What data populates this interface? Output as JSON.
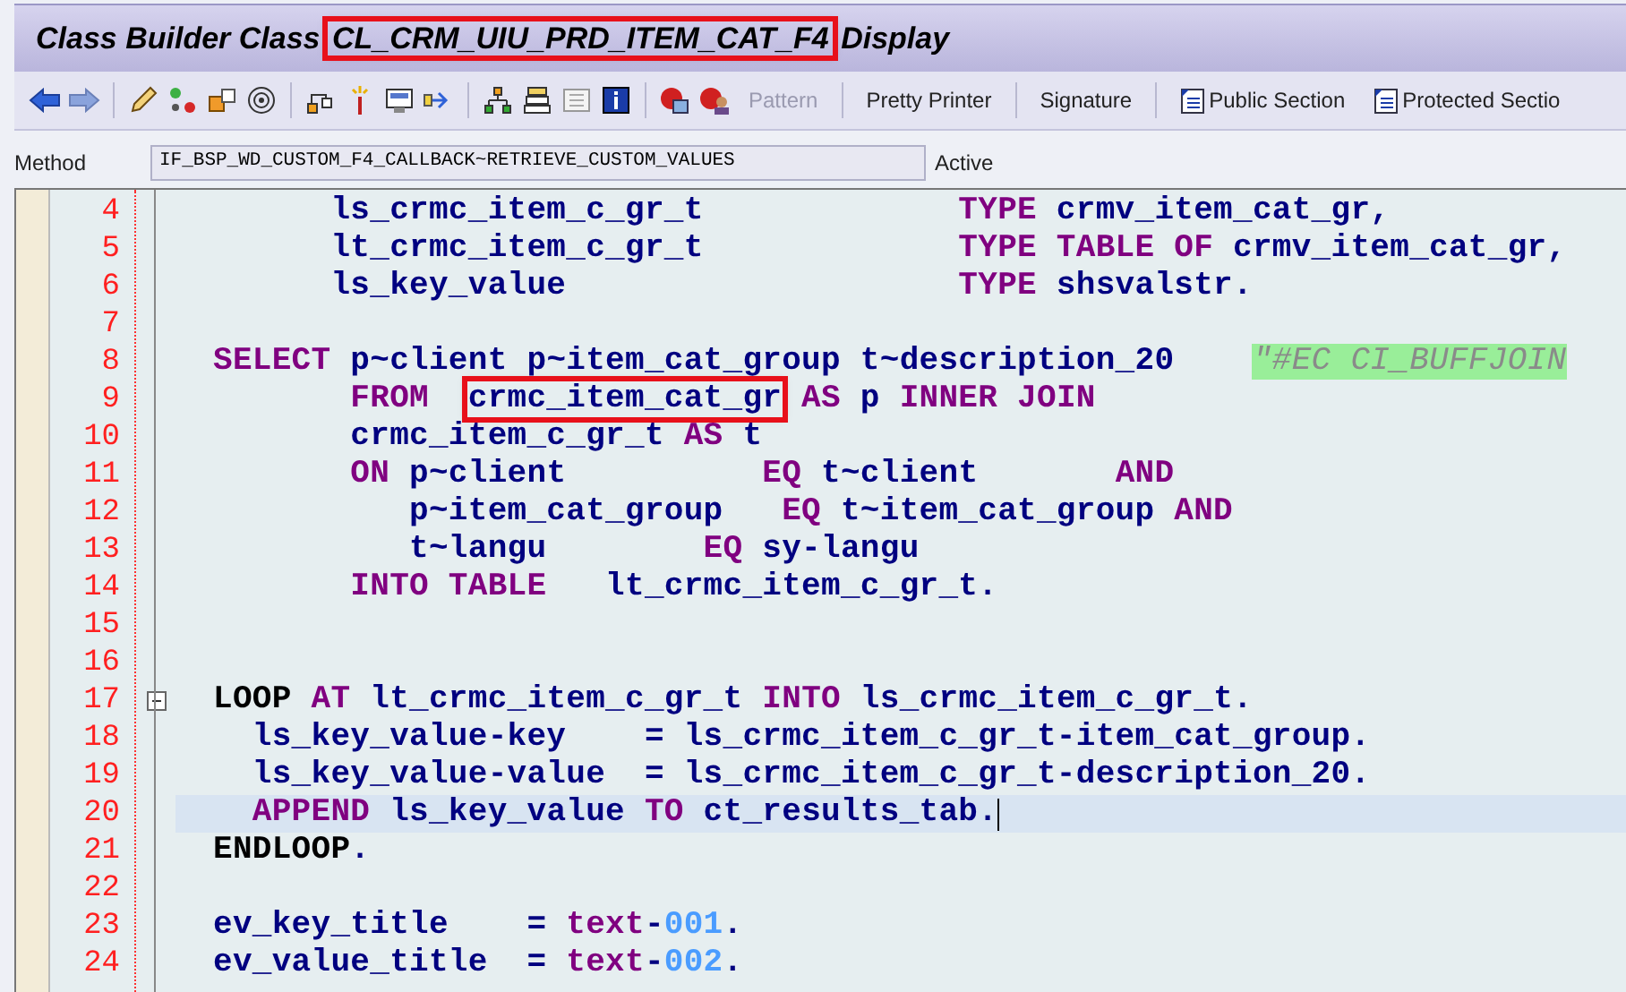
{
  "window": {
    "title": [
      {
        "text": "Class Builder Class ",
        "boxed": false
      },
      {
        "text": "CL_CRM_UIU_PRD_ITEM_CAT_F4",
        "boxed": true
      },
      {
        "text": " Display",
        "boxed": false
      }
    ]
  },
  "toolbar": {
    "buttons": [
      {
        "label": "Pattern",
        "disabled": true,
        "kind": "text"
      },
      {
        "label": "Pretty Printer",
        "disabled": false,
        "kind": "text"
      },
      {
        "label": "Signature",
        "disabled": false,
        "kind": "text"
      },
      {
        "label": "Public Section",
        "disabled": false,
        "kind": "doc"
      },
      {
        "label": "Protected Sectio",
        "disabled": false,
        "kind": "doc"
      }
    ]
  },
  "method_bar": {
    "label": "Method",
    "value": "IF_BSP_WD_CUSTOM_F4_CALLBACK~RETRIEVE_CUSTOM_VALUES",
    "status": "Active"
  },
  "editor": {
    "lines": [
      {
        "number": "4",
        "current": false,
        "fold": false,
        "segments": [
          {
            "kind": "ident",
            "text": "      ls_crmc_item_c_gr_t             "
          },
          {
            "kind": "keyword",
            "text": "TYPE"
          },
          {
            "kind": "ident",
            "text": " crmv_item_cat_gr,"
          }
        ]
      },
      {
        "number": "5",
        "current": false,
        "fold": false,
        "segments": [
          {
            "kind": "ident",
            "text": "      lt_crmc_item_c_gr_t             "
          },
          {
            "kind": "keyword",
            "text": "TYPE TABLE OF"
          },
          {
            "kind": "ident",
            "text": " crmv_item_cat_gr,"
          }
        ]
      },
      {
        "number": "6",
        "current": false,
        "fold": false,
        "segments": [
          {
            "kind": "ident",
            "text": "      ls_key_value                    "
          },
          {
            "kind": "keyword",
            "text": "TYPE"
          },
          {
            "kind": "ident",
            "text": " shsvalstr."
          }
        ]
      },
      {
        "number": "7",
        "current": false,
        "fold": false
      },
      {
        "number": "8",
        "current": false,
        "fold": false,
        "segments": [
          {
            "kind": "keyword",
            "text": "SELECT"
          },
          {
            "kind": "ident",
            "text": " p~client p~item_cat_group t~description_20    "
          },
          {
            "kind": "comment",
            "text": "\"#EC CI_BUFFJOIN"
          }
        ]
      },
      {
        "number": "9",
        "current": false,
        "fold": false,
        "segments": [
          {
            "kind": "keyword",
            "text": "       FROM  "
          },
          {
            "kind": "ident",
            "text": "crmc_item_cat_gr",
            "boxed": true
          },
          {
            "kind": "keyword",
            "text": " AS"
          },
          {
            "kind": "ident",
            "text": " p "
          },
          {
            "kind": "keyword",
            "text": "INNER JOIN"
          }
        ]
      },
      {
        "number": "10",
        "current": false,
        "fold": false,
        "segments": [
          {
            "kind": "ident",
            "text": "       crmc_item_c_gr_t "
          },
          {
            "kind": "keyword",
            "text": "AS"
          },
          {
            "kind": "ident",
            "text": " t"
          }
        ]
      },
      {
        "number": "11",
        "current": false,
        "fold": false,
        "segments": [
          {
            "kind": "keyword",
            "text": "       ON"
          },
          {
            "kind": "ident",
            "text": " p~client          "
          },
          {
            "kind": "keyword",
            "text": "EQ"
          },
          {
            "kind": "ident",
            "text": " t~client       "
          },
          {
            "kind": "keyword",
            "text": "AND"
          }
        ]
      },
      {
        "number": "12",
        "current": false,
        "fold": false,
        "segments": [
          {
            "kind": "ident",
            "text": "          p~item_cat_group   "
          },
          {
            "kind": "keyword",
            "text": "EQ"
          },
          {
            "kind": "ident",
            "text": " t~item_cat_group "
          },
          {
            "kind": "keyword",
            "text": "AND"
          }
        ]
      },
      {
        "number": "13",
        "current": false,
        "fold": false,
        "segments": [
          {
            "kind": "ident",
            "text": "          t~langu        "
          },
          {
            "kind": "keyword",
            "text": "EQ"
          },
          {
            "kind": "ident",
            "text": " sy-langu"
          }
        ]
      },
      {
        "number": "14",
        "current": false,
        "fold": false,
        "segments": [
          {
            "kind": "keyword",
            "text": "       INTO TABLE"
          },
          {
            "kind": "ident",
            "text": "   lt_crmc_item_c_gr_t."
          }
        ]
      },
      {
        "number": "15",
        "current": false,
        "fold": false
      },
      {
        "number": "16",
        "current": false,
        "fold": false
      },
      {
        "number": "17",
        "current": false,
        "fold": true,
        "segments": [
          {
            "kind": "statement",
            "text": "LOOP"
          },
          {
            "kind": "keyword",
            "text": " AT"
          },
          {
            "kind": "ident",
            "text": " lt_crmc_item_c_gr_t "
          },
          {
            "kind": "keyword",
            "text": "INTO"
          },
          {
            "kind": "ident",
            "text": " ls_crmc_item_c_gr_t."
          }
        ]
      },
      {
        "number": "18",
        "current": false,
        "fold": false,
        "segments": [
          {
            "kind": "ident",
            "text": "  ls_key_value-key    = ls_crmc_item_c_gr_t-item_cat_group."
          }
        ]
      },
      {
        "number": "19",
        "current": false,
        "fold": false,
        "segments": [
          {
            "kind": "ident",
            "text": "  ls_key_value-value  = ls_crmc_item_c_gr_t-description_20."
          }
        ]
      },
      {
        "number": "20",
        "current": true,
        "fold": false,
        "segments": [
          {
            "kind": "keyword",
            "text": "  APPEND"
          },
          {
            "kind": "ident",
            "text": " ls_key_value "
          },
          {
            "kind": "keyword",
            "text": "TO"
          },
          {
            "kind": "ident",
            "text": " ct_results_tab."
          }
        ]
      },
      {
        "number": "21",
        "current": false,
        "fold": false,
        "segments": [
          {
            "kind": "statement",
            "text": "ENDLOOP"
          },
          {
            "kind": "ident",
            "text": "."
          }
        ]
      },
      {
        "number": "22",
        "current": false,
        "fold": false
      },
      {
        "number": "23",
        "current": false,
        "fold": false,
        "segments": [
          {
            "kind": "ident",
            "text": "ev_key_title    = "
          },
          {
            "kind": "keyword",
            "text": "text"
          },
          {
            "kind": "ident",
            "text": "-"
          },
          {
            "kind": "literal",
            "text": "001"
          },
          {
            "kind": "ident",
            "text": "."
          }
        ]
      },
      {
        "number": "24",
        "current": false,
        "fold": false,
        "segments": [
          {
            "kind": "ident",
            "text": "ev_value_title  = "
          },
          {
            "kind": "keyword",
            "text": "text"
          },
          {
            "kind": "ident",
            "text": "-"
          },
          {
            "kind": "literal",
            "text": "002"
          },
          {
            "kind": "ident",
            "text": "."
          }
        ]
      }
    ]
  }
}
